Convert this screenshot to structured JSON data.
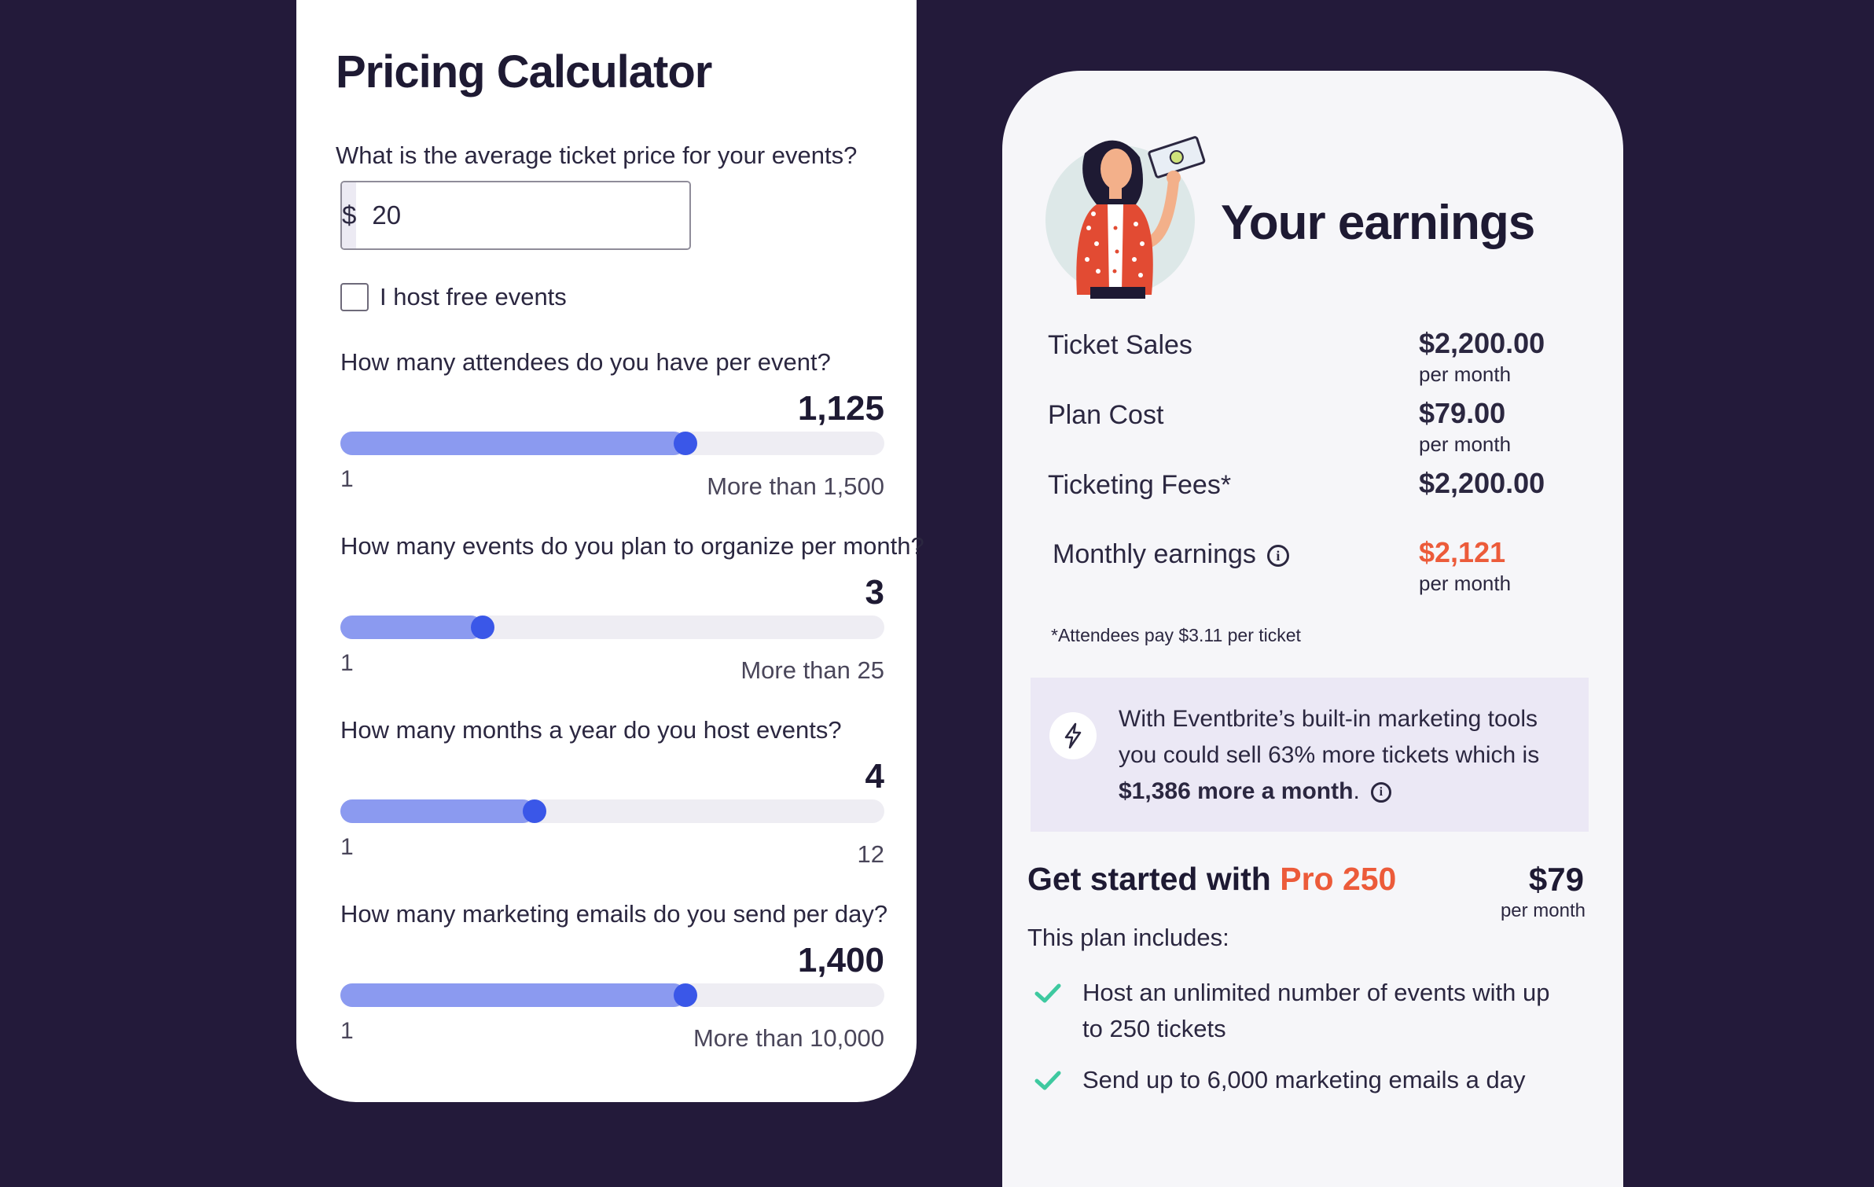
{
  "calculator": {
    "title": "Pricing Calculator",
    "price_question": "What is the average ticket price for your events?",
    "currency_symbol": "$",
    "price_value": "20",
    "free_events_label": "I host free events",
    "sliders": [
      {
        "question": "How many attendees do you have per event?",
        "value": "1,125",
        "min": "1",
        "max": "More than 1,500",
        "fraction": 0.635
      },
      {
        "question": "How many events do you plan to organize per month?",
        "value": "3",
        "min": "1",
        "max": "More than 25",
        "fraction": 0.262
      },
      {
        "question": "How many months a year do you host events?",
        "value": "4",
        "min": "1",
        "max": "12",
        "fraction": 0.357
      },
      {
        "question": "How many marketing emails do you send per day?",
        "value": "1,400",
        "min": "1",
        "max": "More than 10,000",
        "fraction": 0.635
      }
    ]
  },
  "earnings": {
    "title": "Your earnings",
    "rows": [
      {
        "label": "Ticket Sales",
        "amount": "$2,200.00",
        "period": "per month"
      },
      {
        "label": "Plan Cost",
        "amount": "$79.00",
        "period": "per month"
      },
      {
        "label": "Ticketing Fees*",
        "amount": "$2,200.00",
        "period": ""
      }
    ],
    "monthly": {
      "label": "Monthly earnings",
      "amount": "$2,121",
      "period": "per month"
    },
    "footnote": "*Attendees pay $3.11 per ticket",
    "promo": {
      "line1": "With Eventbrite’s built-in marketing tools",
      "line2": "you could sell 63% more tickets which is",
      "highlight": "$1,386 more a month",
      "suffix": "."
    },
    "plan": {
      "prefix": "Get started with ",
      "name": "Pro 250",
      "price": "$79",
      "period": "per month",
      "includes_label": "This plan includes:",
      "features": [
        "Host an unlimited number of events with up to 250 tickets",
        "Send up to 6,000 marketing emails a day"
      ]
    }
  },
  "colors": {
    "background": "#231a3a",
    "slider_fill": "#8b9af0",
    "slider_thumb": "#3a57e8",
    "accent": "#ec5b3a",
    "check": "#3ec9a0"
  }
}
